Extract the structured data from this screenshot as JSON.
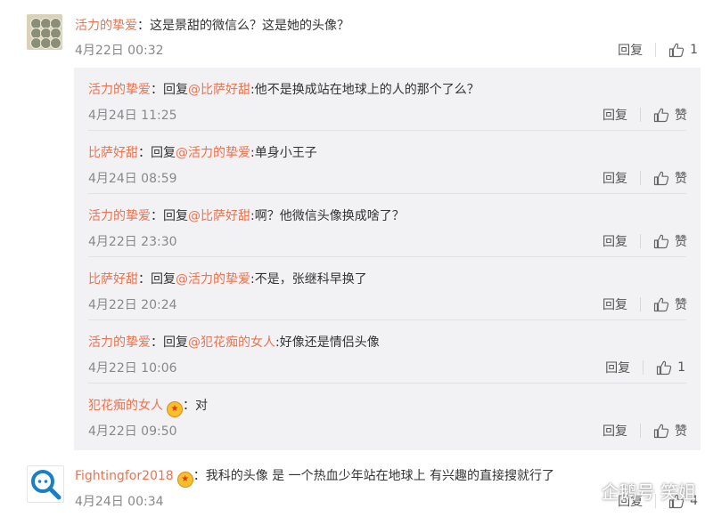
{
  "comments": [
    {
      "user": "活力的挚爱",
      "text": "：这是景甜的微信么？这是她的头像？",
      "time": "4月22日 00:32",
      "reply_label": "回复",
      "like_count": "1"
    },
    {
      "user": "Fightingfor2018",
      "text": "：我科的头像 是 一个热血少年站在地球上 有兴趣的直接搜就行了",
      "time": "4月24日 00:34",
      "reply_label": "回复",
      "like_count": "4"
    }
  ],
  "replies": [
    {
      "user": "活力的挚爱",
      "prefix": "：回复",
      "mention": "@比萨好甜",
      "body": ":他不是换成站在地球上的人的那个了么？",
      "time": "4月24日 11:25",
      "reply_label": "回复",
      "like_label": "赞"
    },
    {
      "user": "比萨好甜",
      "prefix": "：回复",
      "mention": "@活力的挚爱",
      "body": ":单身小王子",
      "time": "4月24日 08:59",
      "reply_label": "回复",
      "like_label": "赞"
    },
    {
      "user": "活力的挚爱",
      "prefix": "：回复",
      "mention": "@比萨好甜",
      "body": ":啊？他微信头像换成啥了？",
      "time": "4月22日 23:30",
      "reply_label": "回复",
      "like_label": "赞"
    },
    {
      "user": "比萨好甜",
      "prefix": "：回复",
      "mention": "@活力的挚爱",
      "body": ":不是，张继科早换了",
      "time": "4月22日 20:24",
      "reply_label": "回复",
      "like_label": "赞"
    },
    {
      "user": "活力的挚爱",
      "prefix": "：回复",
      "mention": "@犯花痴的女人",
      "body": ":好像还是情侣头像",
      "time": "4月22日 10:06",
      "reply_label": "回复",
      "like_label": "1"
    },
    {
      "user": "犯花痴的女人",
      "prefix": "",
      "mention": "",
      "body": "：对",
      "time": "4月22日 09:50",
      "reply_label": "回复",
      "like_label": "赞"
    }
  ],
  "icons": {
    "like": "thumbs-up-icon",
    "badge": "crown-badge-icon",
    "avatar2": "magnifier-icon"
  },
  "colors": {
    "username": "#eb7350",
    "reply_bg": "#f2f2f5",
    "text": "#333333",
    "meta": "#888888"
  },
  "watermark": "企鹅号 笑姐"
}
